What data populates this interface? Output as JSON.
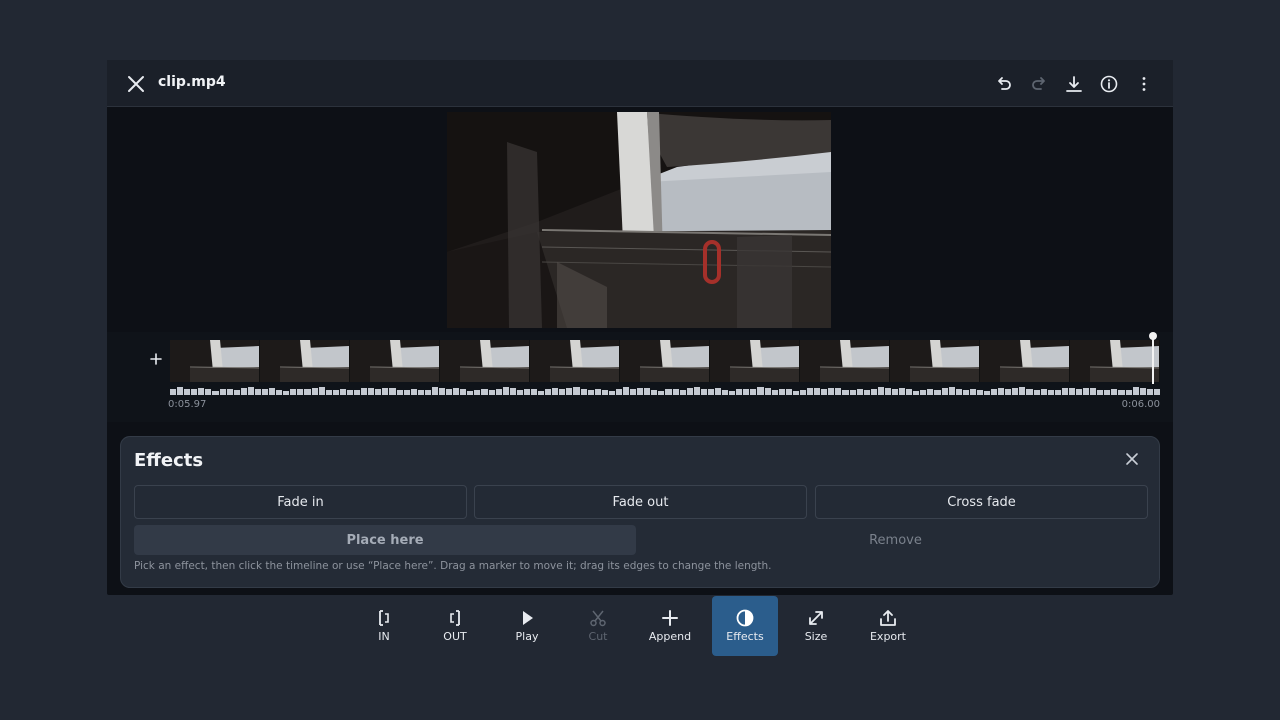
{
  "window": {
    "file_name": "clip.mp4",
    "toolbar_icons": [
      "undo-icon",
      "redo-icon",
      "download-icon",
      "info-icon",
      "more-vertical-icon"
    ]
  },
  "timeline": {
    "time_start": "0:05.97",
    "time_end": "0:06.00",
    "playhead_position_fraction": 0.99
  },
  "effects": {
    "title": "Effects",
    "options": [
      "Fade in",
      "Fade out",
      "Cross fade"
    ],
    "place_label": "Place here",
    "remove_label": "Remove",
    "hint": "Pick an effect, then click the timeline or use “Place here”. Drag a marker to move it; drag its edges to change the length."
  },
  "toolbar": {
    "tools": [
      {
        "label": "IN",
        "icon": "mark-in-icon",
        "enabled": true,
        "active": false
      },
      {
        "label": "OUT",
        "icon": "mark-out-icon",
        "enabled": true,
        "active": false
      },
      {
        "label": "Play",
        "icon": "play-icon",
        "enabled": true,
        "active": false
      },
      {
        "label": "Cut",
        "icon": "scissors-icon",
        "enabled": false,
        "active": false
      },
      {
        "label": "Append",
        "icon": "plus-icon",
        "enabled": true,
        "active": false
      },
      {
        "label": "Effects",
        "icon": "contrast-icon",
        "enabled": true,
        "active": true
      },
      {
        "label": "Size",
        "icon": "resize-icon",
        "enabled": true,
        "active": false
      },
      {
        "label": "Export",
        "icon": "share-icon",
        "enabled": true,
        "active": false
      }
    ]
  },
  "colors": {
    "accent": "#2b5d8c",
    "background": "#222833",
    "panel": "#242b36"
  }
}
